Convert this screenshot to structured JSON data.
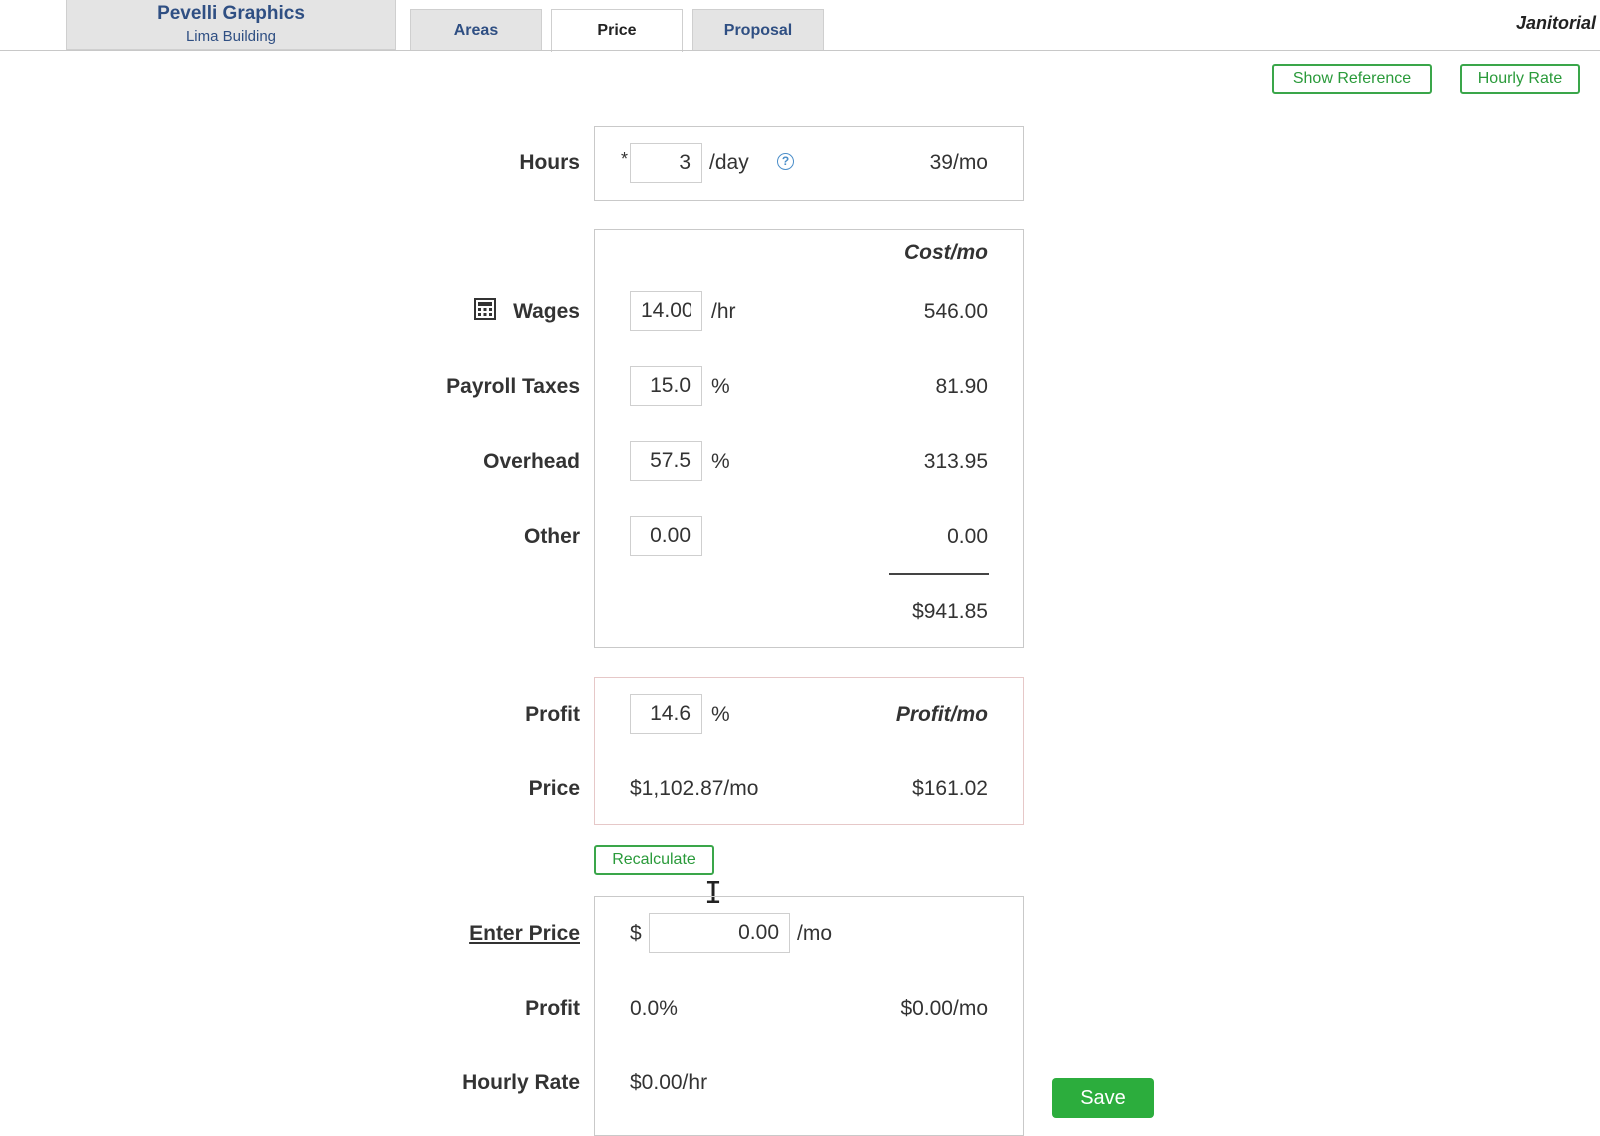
{
  "header": {
    "client_name": "Pevelli Graphics",
    "client_building": "Lima Building",
    "tabs": [
      {
        "label": "Areas",
        "active": false
      },
      {
        "label": "Price",
        "active": true
      },
      {
        "label": "Proposal",
        "active": false
      }
    ],
    "page_title": "Janitorial"
  },
  "actions": {
    "show_reference": "Show Reference",
    "hourly_rate": "Hourly Rate",
    "recalculate": "Recalculate",
    "save": "Save"
  },
  "hours": {
    "label": "Hours",
    "asterisk": "*",
    "value": "3",
    "unit": "/day",
    "monthly": "39/mo"
  },
  "costs": {
    "column_header": "Cost/mo",
    "rows": [
      {
        "label": "Wages",
        "input": "14.00",
        "unit": "/hr",
        "cost": "546.00"
      },
      {
        "label": "Payroll Taxes",
        "input": "15.0",
        "unit": "%",
        "cost": "81.90"
      },
      {
        "label": "Overhead",
        "input": "57.5",
        "unit": "%",
        "cost": "313.95"
      },
      {
        "label": "Other",
        "input": "0.00",
        "unit": "",
        "cost": "0.00"
      }
    ],
    "total": "$941.85"
  },
  "profit": {
    "label": "Profit",
    "input": "14.6",
    "unit": "%",
    "column_header": "Profit/mo",
    "price_label": "Price",
    "price": "$1,102.87/mo",
    "profit_amount": "$161.02"
  },
  "enter_price": {
    "label": "Enter Price",
    "currency": "$",
    "value": "0.00",
    "unit": "/mo",
    "profit_label": "Profit",
    "profit_pct": "0.0%",
    "profit_amount": "$0.00/mo",
    "hourly_rate_label": "Hourly Rate",
    "hourly_rate": "$0.00/hr"
  },
  "colors": {
    "accent_green": "#2cad3d",
    "tab_text": "#2f4f83",
    "help_blue": "#4b8ec9"
  }
}
